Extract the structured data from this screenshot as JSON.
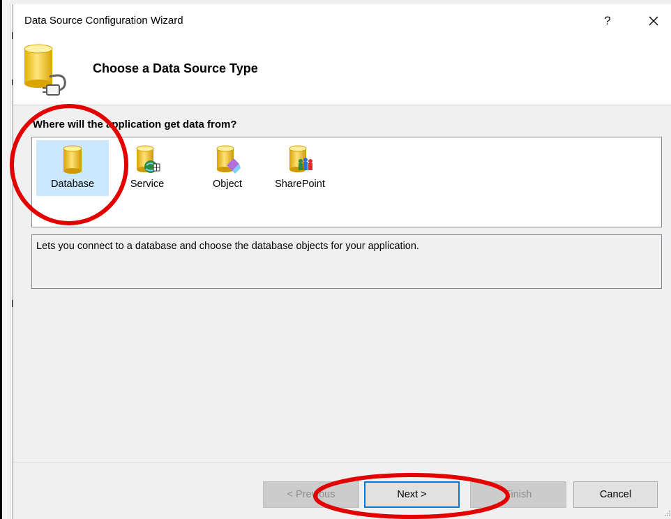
{
  "dialog": {
    "title": "Data Source Configuration Wizard",
    "help_label": "?",
    "close_label": "✕"
  },
  "header": {
    "title": "Choose a Data Source Type",
    "icon": "database-plug-icon"
  },
  "question": "Where will the application get data from?",
  "sources": [
    {
      "label": "Database",
      "icon": "database-icon",
      "selected": true
    },
    {
      "label": "Service",
      "icon": "service-icon",
      "selected": false
    },
    {
      "label": "Object",
      "icon": "object-icon",
      "selected": false
    },
    {
      "label": "SharePoint",
      "icon": "sharepoint-icon",
      "selected": false
    }
  ],
  "description": "Lets you connect to a database and choose the database objects for your application.",
  "buttons": {
    "previous": "< Previous",
    "next": "Next >",
    "finish": "Finish",
    "cancel": "Cancel"
  },
  "colors": {
    "selection": "#cce8ff",
    "annotation": "#e30000",
    "focus": "#0078d7"
  }
}
